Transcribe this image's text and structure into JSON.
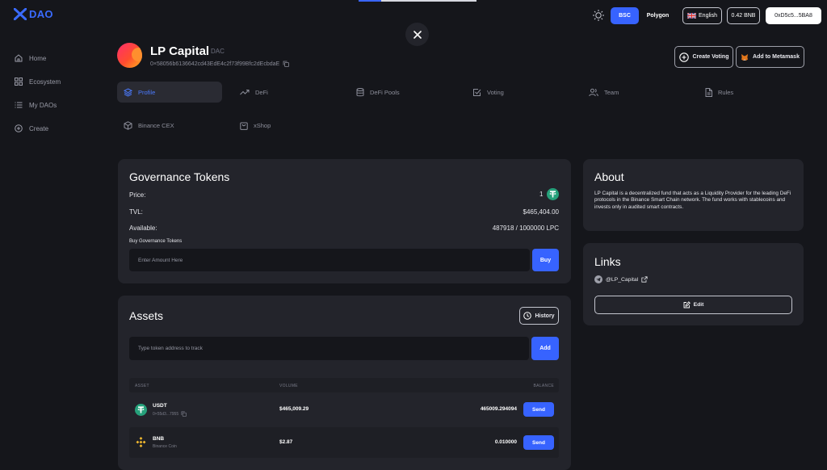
{
  "brand": {
    "logo_text": "DAO"
  },
  "header": {
    "networks": [
      "BSC",
      "Polygon"
    ],
    "language": "English",
    "balance": "0.42 BNB",
    "wallet": "0xD5c5...5BA8"
  },
  "sidebar": {
    "items": [
      {
        "label": "Home",
        "icon": "home-icon"
      },
      {
        "label": "Ecosystem",
        "icon": "grid-icon"
      },
      {
        "label": "My DAOs",
        "icon": "list-icon"
      },
      {
        "label": "Create",
        "icon": "plus-circle-icon"
      }
    ]
  },
  "dao": {
    "name": "LP Capital",
    "type": "DAC",
    "address": "0×58056b6136642cd43EdE4c2f73f99Bfc2dEcbdaE",
    "create_voting_label": "Create Voting",
    "add_metamask_label": "Add to Metamask"
  },
  "tabs": [
    {
      "label": "Profile",
      "icon": "layers-icon"
    },
    {
      "label": "DeFi",
      "icon": "trend-icon"
    },
    {
      "label": "DeFi Pools",
      "icon": "database-icon"
    },
    {
      "label": "Voting",
      "icon": "checkbox-icon"
    },
    {
      "label": "Team",
      "icon": "users-icon"
    },
    {
      "label": "Rules",
      "icon": "document-icon"
    },
    {
      "label": "Binance CEX",
      "icon": "cube-icon"
    },
    {
      "label": "xShop",
      "icon": "bag-icon"
    }
  ],
  "governance": {
    "title": "Governance Tokens",
    "price_label": "Price:",
    "price_value": "1",
    "tvl_label": "TVL:",
    "tvl_value": "$465,404.00",
    "available_label": "Available:",
    "available_value": "487918 / 1000000 LPC",
    "buy_label": "Buy Governance Tokens",
    "amount_placeholder": "Enter Amount Here",
    "buy_button": "Buy"
  },
  "assets": {
    "title": "Assets",
    "history_button": "History",
    "token_placeholder": "Type token address to track",
    "add_button": "Add",
    "columns": [
      "ASSET",
      "VOLUME",
      "BALANCE"
    ],
    "rows": [
      {
        "symbol": "USDT",
        "sub": "0×55d3...7955",
        "volume": "$465,009.29",
        "balance": "465009.294094",
        "action": "Send",
        "icon": "tether-icon",
        "color": "#26a17b"
      },
      {
        "symbol": "BNB",
        "sub": "Binance Coin",
        "volume": "$2.87",
        "balance": "0.010000",
        "action": "Send",
        "icon": "bnb-icon",
        "color": "#f3ba2f"
      }
    ]
  },
  "about": {
    "title": "About",
    "text": "LP Capital is a decentralized fund that acts as a Liquidity Provider for the leading DeFi protocols in the Binance Smart Chain network. The fund works with stablecoins and invests only in audited smart contracts."
  },
  "links": {
    "title": "Links",
    "telegram": "@LP_Capital",
    "edit_button": "Edit"
  },
  "colors": {
    "accent": "#3763ff",
    "background": "#15161b",
    "card": "#23242b"
  }
}
